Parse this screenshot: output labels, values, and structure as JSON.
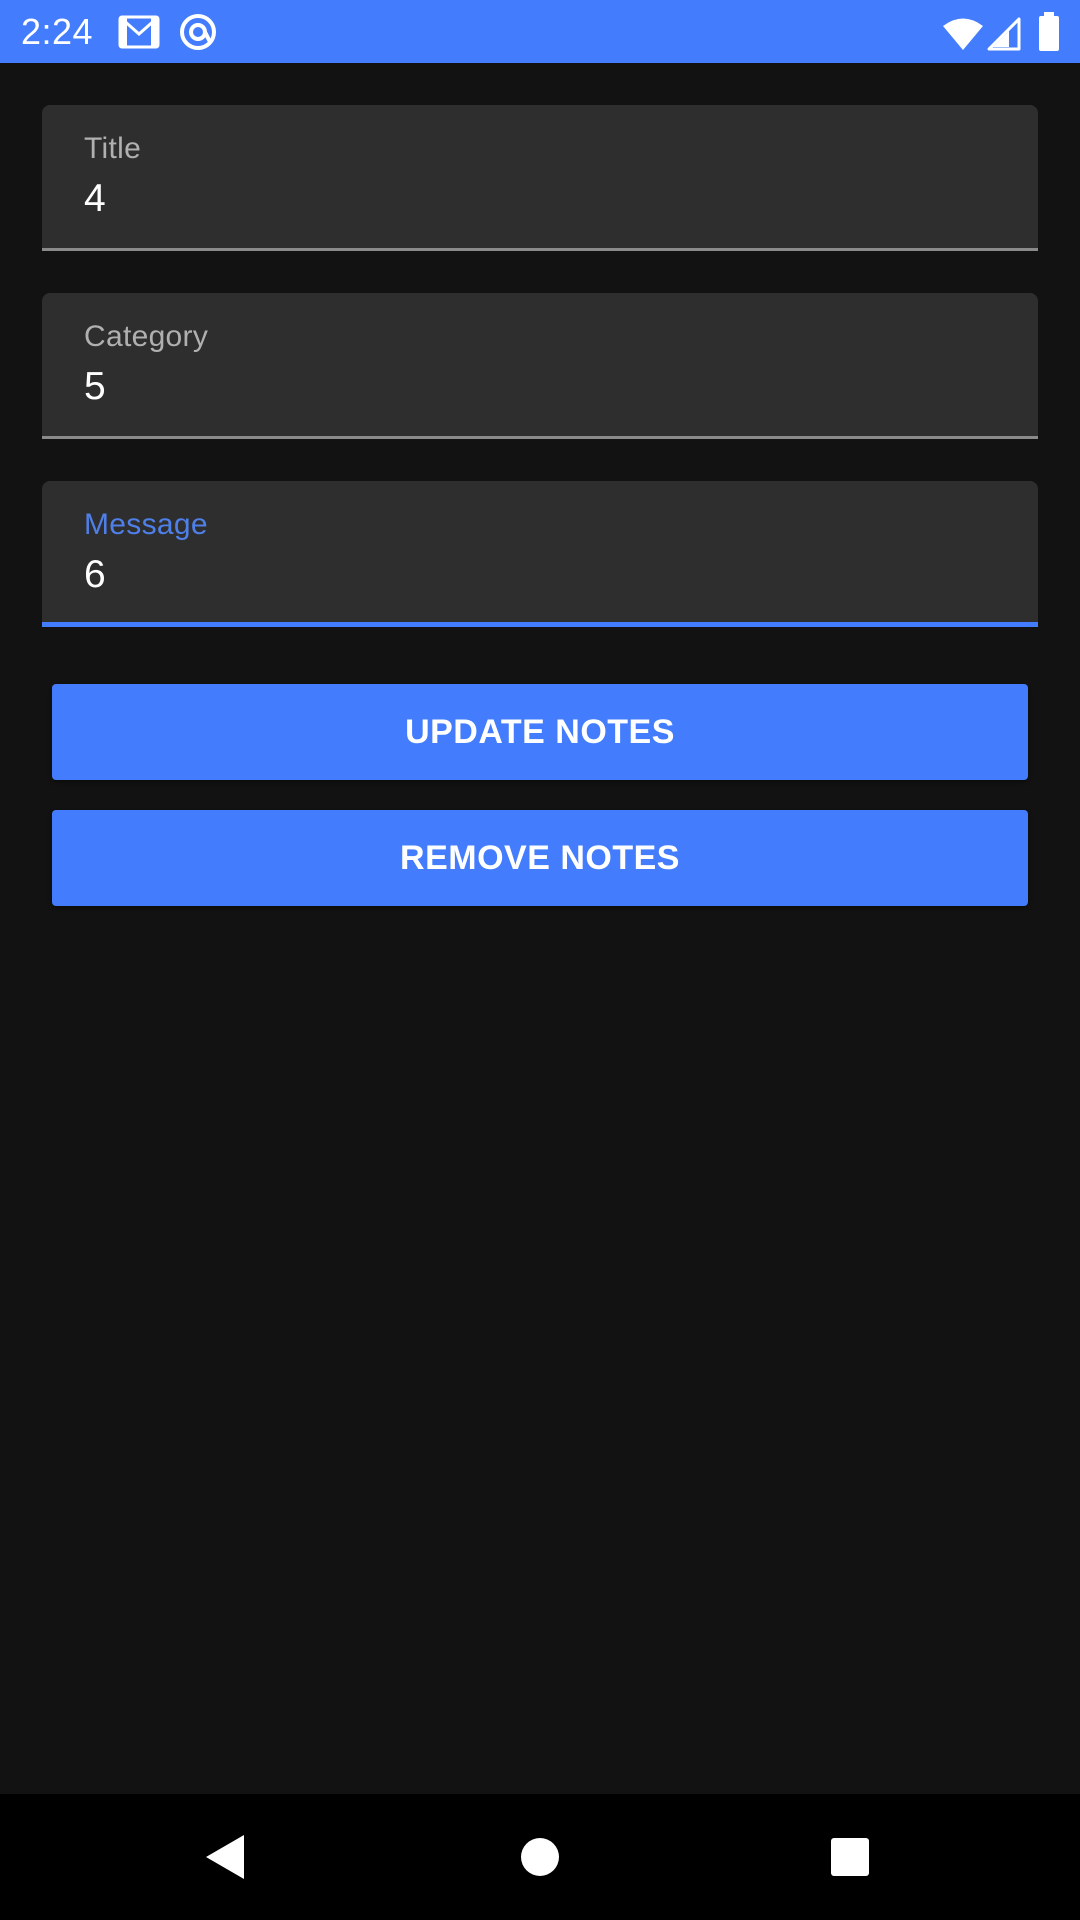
{
  "status_bar": {
    "time": "2:24",
    "background_color": "#437DFD",
    "icons": [
      "gmail-icon",
      "circle-at-icon",
      "wifi-icon",
      "signal-icon",
      "battery-icon"
    ]
  },
  "form": {
    "title_field": {
      "label": "Title",
      "value": "4"
    },
    "category_field": {
      "label": "Category",
      "value": "5"
    },
    "message_field": {
      "label": "Message",
      "value": "6",
      "focused": true
    }
  },
  "buttons": {
    "update_label": "UPDATE NOTES",
    "remove_label": "REMOVE NOTES"
  },
  "colors": {
    "accent": "#437DFD",
    "background": "#121212",
    "field_background": "#2E2E2E"
  },
  "nav_bar": {
    "icons": [
      "back-icon",
      "home-icon",
      "recents-icon"
    ]
  }
}
